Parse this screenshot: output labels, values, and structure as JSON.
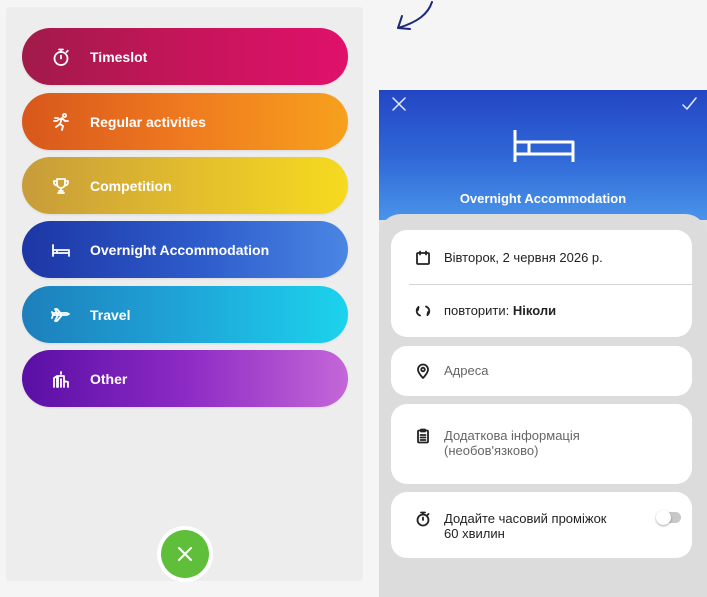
{
  "categories": [
    {
      "label": "Timeslot",
      "icon": "stopwatch-icon"
    },
    {
      "label": "Regular activities",
      "icon": "running-icon"
    },
    {
      "label": "Competition",
      "icon": "trophy-icon"
    },
    {
      "label": "Overnight Accommodation",
      "icon": "bed-icon"
    },
    {
      "label": "Travel",
      "icon": "airplane-icon"
    },
    {
      "label": "Other",
      "icon": "other-icon"
    }
  ],
  "colors": {
    "close_fab": "#5fbf3a",
    "header_top": "#2346c4",
    "header_bottom": "#4a94ea"
  },
  "detail": {
    "title": "Overnight Accommodation",
    "date": "Вівторок, 2 червня 2026 р.",
    "repeat_prefix": "повторити:",
    "repeat_value": "Ніколи",
    "address_placeholder": "Адреса",
    "info_placeholder_line1": "Додаткова інформація",
    "info_placeholder_line2": "(необов'язково)",
    "reminder_line1": "Додайте часовий проміжок",
    "reminder_line2": "60 хвилин",
    "reminder_enabled": false
  }
}
